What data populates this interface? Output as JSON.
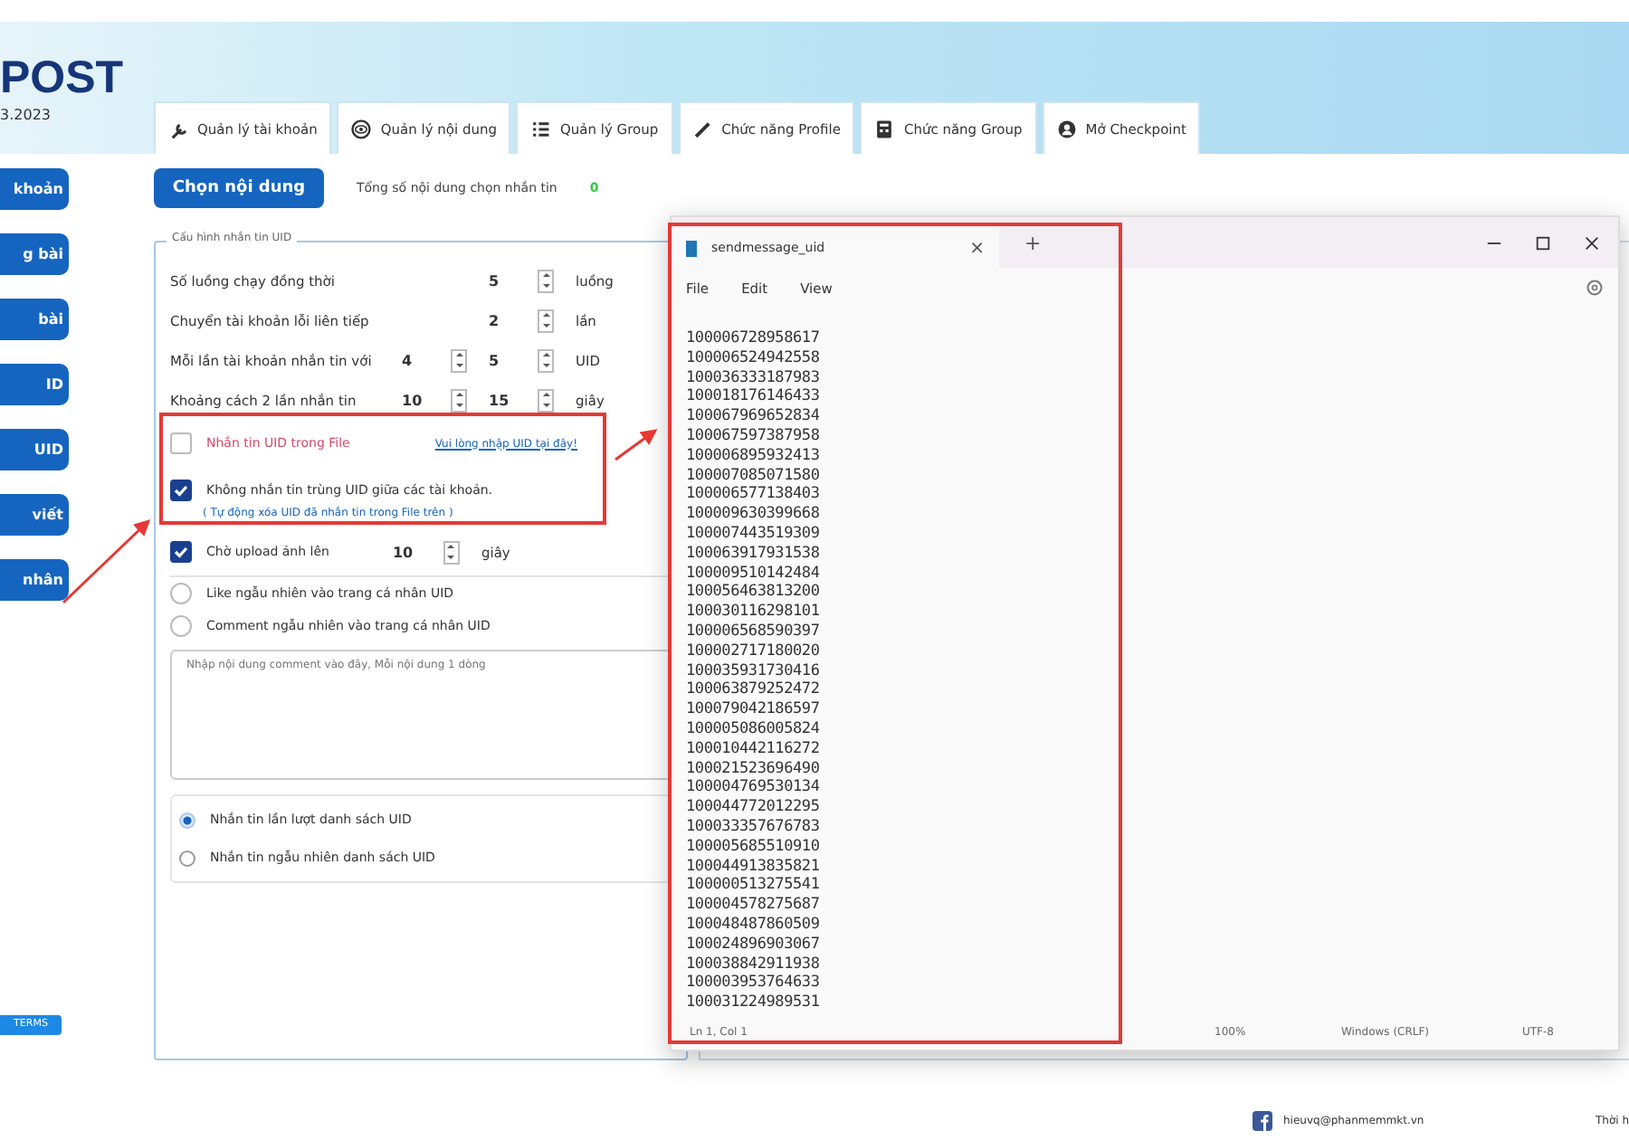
{
  "header": {
    "logo": "POST",
    "version": "3.2023"
  },
  "sidebar": {
    "buttons": [
      "khoản",
      "g bài",
      "bài",
      "ID",
      "UID",
      "viết",
      "nhân"
    ],
    "badge": "TERMS"
  },
  "tabs": [
    {
      "label": "Quản lý tài khoản",
      "selected": false
    },
    {
      "label": "Quản lý nội dung",
      "selected": false
    },
    {
      "label": "Quản lý Group",
      "selected": false
    },
    {
      "label": "Chức năng Profile",
      "selected": false
    },
    {
      "label": "Chức năng Group",
      "selected": false
    },
    {
      "label": "Mở Checkpoint",
      "selected": false
    }
  ],
  "content": {
    "choose_button": "Chọn nội dung",
    "counter_label": "Tổng số nội dung chọn nhắn tin",
    "counter_value": "0"
  },
  "config": {
    "title": "Cấu hình nhắn tin UID",
    "items": [
      {
        "kind": "spin",
        "label": "Số luồng chạy đồng thời",
        "values": [
          "5"
        ],
        "unit": "luồng"
      },
      {
        "kind": "spin",
        "label": "Chuyển tài khoản lỗi liên tiếp",
        "values": [
          "2"
        ],
        "unit": "lần"
      },
      {
        "kind": "spin",
        "label": "Mỗi lần tài khoản nhắn tin với",
        "values": [
          "4",
          "5"
        ],
        "unit": "UID"
      },
      {
        "kind": "spin",
        "label": "Khoảng cách 2 lần nhắn tin",
        "values": [
          "10",
          "15"
        ],
        "unit": "giây"
      },
      {
        "kind": "check",
        "label": "Nhắn tin UID trong File",
        "checked": false,
        "emphasis": true,
        "link": "Vui lòng nhập UID tại đây!"
      },
      {
        "kind": "check",
        "label": "Không nhắn tin trùng UID giữa các tài khoản.",
        "checked": true,
        "emphasis": false,
        "note": "( Tự động xóa UID đã nhắn tin trong File trên )"
      },
      {
        "kind": "check",
        "label": "Chờ upload ảnh lên",
        "checked": true,
        "emphasis": false,
        "values": [
          "10"
        ],
        "unit": "giây"
      },
      {
        "kind": "round",
        "label": "Like ngẫu nhiên vào trang cá nhân UID",
        "checked": false
      },
      {
        "kind": "round",
        "label": "Comment ngẫu nhiên vào trang cá nhân UID",
        "checked": false
      },
      {
        "kind": "textarea",
        "placeholder": "Nhập nội dung comment vào đây, Mỗi nội dung 1 dòng"
      }
    ],
    "order": [
      {
        "label": "Nhắn tin lần lượt danh sách UID",
        "selected": true
      },
      {
        "label": "Nhắn tin ngẫu nhiên danh sách UID",
        "selected": false
      }
    ]
  },
  "notepad": {
    "tab_title": "sendmessage_uid",
    "tab_close": "×",
    "new_tab": "+",
    "menu": [
      "File",
      "Edit",
      "View"
    ],
    "lines": [
      "100006728958617",
      "100006524942558",
      "100036333187983",
      "100018176146433",
      "100067969652834",
      "100067597387958",
      "100006895932413",
      "100007085071580",
      "100006577138403",
      "100009630399668",
      "100007443519309",
      "100063917931538",
      "100009510142484",
      "100056463813200",
      "100030116298101",
      "100006568590397",
      "100002717180020",
      "100035931730416",
      "100063879252472",
      "100079042186597",
      "100005086005824",
      "100010442116272",
      "100021523696490",
      "100004769530134",
      "100044772012295",
      "100033357676783",
      "100005685510910",
      "100044913835821",
      "100000513275541",
      "100004578275687",
      "100048487860509",
      "100024896903067",
      "100038842911938",
      "100003953764633",
      "100031224989531"
    ],
    "status": [
      "Ln 1, Col 1",
      "100%",
      "Windows (CRLF)",
      "UTF-8"
    ]
  },
  "footer": {
    "email": "hieuvq@phanmemmkt.vn",
    "right_text": "Thời h"
  }
}
